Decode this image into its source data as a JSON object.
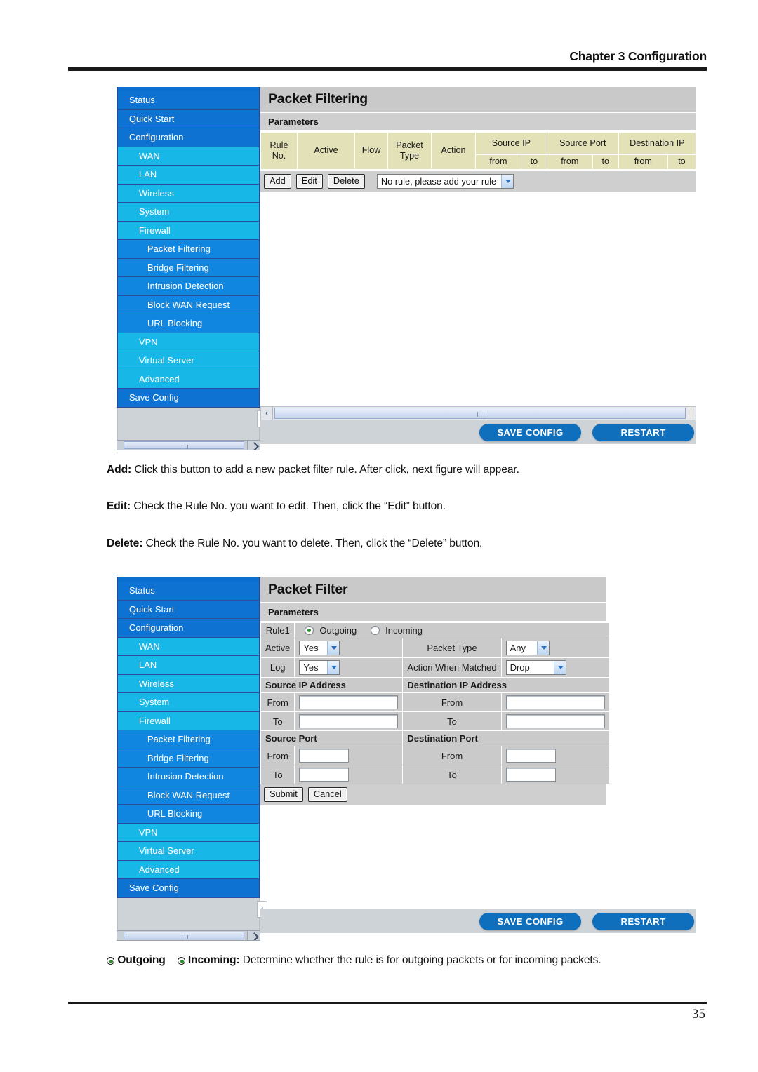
{
  "page": {
    "chapter_header": "Chapter 3 Configuration",
    "page_number": "35"
  },
  "sidebar": {
    "items": [
      {
        "label": "Status",
        "level": 0
      },
      {
        "label": "Quick Start",
        "level": 0
      },
      {
        "label": "Configuration",
        "level": 0
      },
      {
        "label": "WAN",
        "level": 1
      },
      {
        "label": "LAN",
        "level": 1
      },
      {
        "label": "Wireless",
        "level": 1
      },
      {
        "label": "System",
        "level": 1
      },
      {
        "label": "Firewall",
        "level": 1
      },
      {
        "label": "Packet Filtering",
        "level": 2
      },
      {
        "label": "Bridge Filtering",
        "level": 2
      },
      {
        "label": "Intrusion Detection",
        "level": 2
      },
      {
        "label": "Block WAN Request",
        "level": 2
      },
      {
        "label": "URL Blocking",
        "level": 2
      },
      {
        "label": "VPN",
        "level": 1
      },
      {
        "label": "Virtual Server",
        "level": 1
      },
      {
        "label": "Advanced",
        "level": 1
      },
      {
        "label": "Save Config",
        "level": 0
      }
    ],
    "collapse_icon": "‹"
  },
  "figure1": {
    "title": "Packet Filtering",
    "parameters_label": "Parameters",
    "table": {
      "columns": [
        "Rule No.",
        "Active",
        "Flow",
        "Packet Type",
        "Action"
      ],
      "grouped_columns": [
        {
          "label": "Source IP",
          "sub": [
            "from",
            "to"
          ]
        },
        {
          "label": "Source Port",
          "sub": [
            "from",
            "to"
          ]
        },
        {
          "label": "Destination IP",
          "sub": [
            "from",
            "to"
          ]
        }
      ],
      "rows": []
    },
    "buttons": [
      "Add",
      "Edit",
      "Delete"
    ],
    "rule_select_value": "No rule, please add your rule"
  },
  "figure2": {
    "title": "Packet Filter",
    "parameters_label": "Parameters",
    "rule_label": "Rule1",
    "flow_options": [
      {
        "label": "Outgoing",
        "selected": true
      },
      {
        "label": "Incoming",
        "selected": false
      }
    ],
    "fields": {
      "active_label": "Active",
      "active_value": "Yes",
      "packet_type_label": "Packet Type",
      "packet_type_value": "Any",
      "log_label": "Log",
      "log_value": "Yes",
      "action_when_matched_label": "Action When Matched",
      "action_when_matched_value": "Drop"
    },
    "sections": {
      "source_ip": "Source IP Address",
      "destination_ip": "Destination IP Address",
      "source_port": "Source Port",
      "destination_port": "Destination Port"
    },
    "row_labels": {
      "from": "From",
      "to": "To"
    },
    "inputs": {
      "source_ip_from": "",
      "source_ip_to": "",
      "destination_ip_from": "",
      "destination_ip_to": "",
      "source_port_from": "",
      "source_port_to": "",
      "destination_port_from": "",
      "destination_port_to": ""
    },
    "buttons": [
      "Submit",
      "Cancel"
    ]
  },
  "bottom_bar": {
    "save_config": "SAVE CONFIG",
    "restart": "RESTART",
    "scroll_left_icon": "‹"
  },
  "body_text": {
    "add_term": "Add:",
    "add_desc": " Click this button to add a new packet filter rule. After click, next figure will appear.",
    "edit_term": "Edit:",
    "edit_desc": " Check the Rule No. you want to edit. Then, click the “Edit” button.",
    "delete_term": "Delete:",
    "delete_desc": " Check the Rule No. you want to delete. Then, click the “Delete” button.",
    "flow_term_a": "Outgoing",
    "flow_term_b": "Incoming:",
    "flow_desc": " Determine whether the rule is for outgoing packets or for incoming packets."
  },
  "colors": {
    "sidebar_level0": "#0d72d2",
    "sidebar_level1": "#17b7e8",
    "sidebar_level2": "#1186e0",
    "table_header": "#e3e1b8",
    "panel_gray": "#cacaca",
    "button_blue": "#0f6fbd"
  }
}
